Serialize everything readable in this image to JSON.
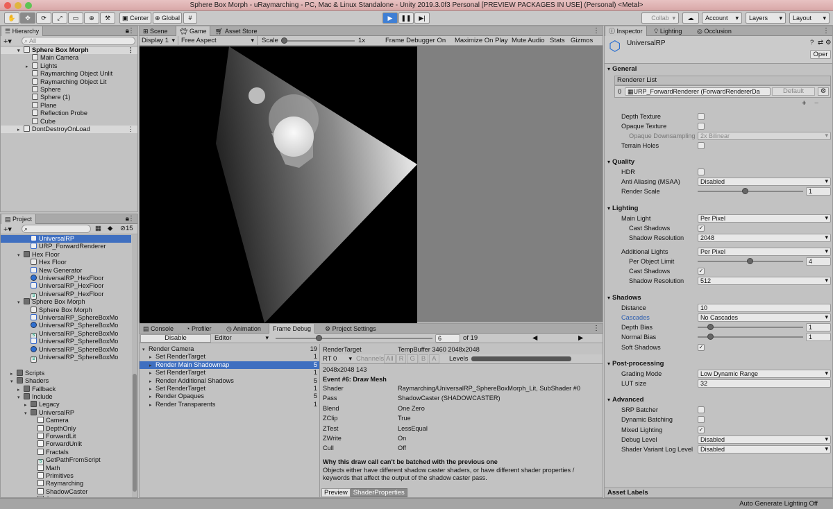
{
  "window": {
    "title": "Sphere Box Morph - uRaymarching - PC, Mac & Linux Standalone - Unity 2019.3.0f3 Personal [PREVIEW PACKAGES IN USE] (Personal) <Metal>"
  },
  "toolbar": {
    "center_label": "Center",
    "global_label": "Global",
    "collab_label": "Collab",
    "account_label": "Account",
    "layers_label": "Layers",
    "layout_label": "Layout"
  },
  "hierarchy": {
    "tab": "Hierarchy",
    "search_placeholder": "All",
    "items": [
      {
        "label": "Sphere Box Morph",
        "indent": 0,
        "icon": "scene",
        "arrow": "▾"
      },
      {
        "label": "Main Camera",
        "indent": 1,
        "icon": "cube",
        "arrow": ""
      },
      {
        "label": "Lights",
        "indent": 1,
        "icon": "cube",
        "arrow": "▸"
      },
      {
        "label": "Raymarching Object Unlit",
        "indent": 1,
        "icon": "cube",
        "arrow": ""
      },
      {
        "label": "Raymarching Object Lit",
        "indent": 1,
        "icon": "cube",
        "arrow": ""
      },
      {
        "label": "Sphere",
        "indent": 1,
        "icon": "cube",
        "arrow": ""
      },
      {
        "label": "Sphere (1)",
        "indent": 1,
        "icon": "cube",
        "arrow": ""
      },
      {
        "label": "Plane",
        "indent": 1,
        "icon": "cube",
        "arrow": ""
      },
      {
        "label": "Reflection Probe",
        "indent": 1,
        "icon": "cube",
        "arrow": ""
      },
      {
        "label": "Cube",
        "indent": 1,
        "icon": "cube",
        "arrow": ""
      },
      {
        "label": "DontDestroyOnLoad",
        "indent": 0,
        "icon": "scene",
        "arrow": "▸"
      }
    ]
  },
  "project": {
    "tab": "Project",
    "count": "15",
    "items": [
      {
        "label": "UniversalRP",
        "indent": 3,
        "icon": "urp",
        "arrow": "",
        "sel": true
      },
      {
        "label": "URP_ForwardRenderer",
        "indent": 3,
        "icon": "urp",
        "arrow": ""
      },
      {
        "label": "Hex Floor",
        "indent": 2,
        "icon": "folder",
        "arrow": "▾"
      },
      {
        "label": "Hex Floor",
        "indent": 3,
        "icon": "cube",
        "arrow": ""
      },
      {
        "label": "New Generator",
        "indent": 3,
        "icon": "urp",
        "arrow": ""
      },
      {
        "label": "UniversalRP_HexFloor",
        "indent": 3,
        "icon": "sphere",
        "arrow": ""
      },
      {
        "label": "UniversalRP_HexFloor",
        "indent": 3,
        "icon": "urp",
        "arrow": ""
      },
      {
        "label": "UniversalRP_HexFloor",
        "indent": 3,
        "icon": "script",
        "arrow": ""
      },
      {
        "label": "Sphere Box Morph",
        "indent": 2,
        "icon": "folder",
        "arrow": "▾"
      },
      {
        "label": "Sphere Box Morph",
        "indent": 3,
        "icon": "cube",
        "arrow": ""
      },
      {
        "label": "UniversalRP_SphereBoxMo",
        "indent": 3,
        "icon": "urp",
        "arrow": ""
      },
      {
        "label": "UniversalRP_SphereBoxMo",
        "indent": 3,
        "icon": "sphere",
        "arrow": ""
      },
      {
        "label": "UniversalRP_SphereBoxMo",
        "indent": 3,
        "icon": "script",
        "arrow": ""
      },
      {
        "label": "UniversalRP_SphereBoxMo",
        "indent": 3,
        "icon": "urp",
        "arrow": ""
      },
      {
        "label": "UniversalRP_SphereBoxMo",
        "indent": 3,
        "icon": "sphere",
        "arrow": ""
      },
      {
        "label": "UniversalRP_SphereBoxMo",
        "indent": 3,
        "icon": "script",
        "arrow": ""
      },
      {
        "label": "",
        "indent": 0,
        "icon": "none",
        "arrow": ""
      },
      {
        "label": "Scripts",
        "indent": 1,
        "icon": "folder",
        "arrow": "▸"
      },
      {
        "label": "Shaders",
        "indent": 1,
        "icon": "folder",
        "arrow": "▾"
      },
      {
        "label": "Fallback",
        "indent": 2,
        "icon": "folder",
        "arrow": "▸"
      },
      {
        "label": "Include",
        "indent": 2,
        "icon": "folder",
        "arrow": "▾"
      },
      {
        "label": "Legacy",
        "indent": 3,
        "icon": "folder",
        "arrow": "▸"
      },
      {
        "label": "UniversalRP",
        "indent": 3,
        "icon": "folder",
        "arrow": "▾"
      },
      {
        "label": "Camera",
        "indent": 4,
        "icon": "file",
        "arrow": ""
      },
      {
        "label": "DepthOnly",
        "indent": 4,
        "icon": "file",
        "arrow": ""
      },
      {
        "label": "ForwardLit",
        "indent": 4,
        "icon": "file",
        "arrow": ""
      },
      {
        "label": "ForwardUnlit",
        "indent": 4,
        "icon": "file",
        "arrow": ""
      },
      {
        "label": "Fractals",
        "indent": 4,
        "icon": "file",
        "arrow": ""
      },
      {
        "label": "GetPathFromScript",
        "indent": 4,
        "icon": "script",
        "arrow": ""
      },
      {
        "label": "Math",
        "indent": 4,
        "icon": "file",
        "arrow": ""
      },
      {
        "label": "Primitives",
        "indent": 4,
        "icon": "file",
        "arrow": ""
      },
      {
        "label": "Raymarching",
        "indent": 4,
        "icon": "file",
        "arrow": ""
      },
      {
        "label": "ShadowCaster",
        "indent": 4,
        "icon": "file",
        "arrow": ""
      },
      {
        "label": "Structs",
        "indent": 4,
        "icon": "file",
        "arrow": ""
      }
    ]
  },
  "game": {
    "tabs": [
      "Scene",
      "Game",
      "Asset Store"
    ],
    "display": "Display 1",
    "aspect": "Free Aspect",
    "scale_label": "Scale",
    "scale_value": "1x",
    "frame_debugger": "Frame Debugger On",
    "maximize": "Maximize On Play",
    "mute": "Mute Audio",
    "stats": "Stats",
    "gizmos": "Gizmos"
  },
  "framedebug": {
    "tabs": [
      "Console",
      "Profiler",
      "Animation",
      "Frame Debug",
      "Project Settings"
    ],
    "disable_label": "Disable",
    "editor_label": "Editor",
    "event_index": "6",
    "event_total": "of 19",
    "tree": [
      {
        "label": "Render Camera",
        "count": "19",
        "indent": 0,
        "arrow": "▾"
      },
      {
        "label": "Set RenderTarget",
        "count": "1",
        "indent": 1,
        "arrow": "▸"
      },
      {
        "label": "Render Main Shadowmap",
        "count": "5",
        "indent": 1,
        "arrow": "▸",
        "sel": true
      },
      {
        "label": "Set RenderTarget",
        "count": "1",
        "indent": 1,
        "arrow": "▸"
      },
      {
        "label": "Render Additional Shadows",
        "count": "5",
        "indent": 1,
        "arrow": "▸"
      },
      {
        "label": "Set RenderTarget",
        "count": "1",
        "indent": 1,
        "arrow": "▸"
      },
      {
        "label": "Render Opaques",
        "count": "5",
        "indent": 1,
        "arrow": "▸"
      },
      {
        "label": "Render Transparents",
        "count": "1",
        "indent": 1,
        "arrow": "▸"
      }
    ],
    "rendertarget_label": "RenderTarget",
    "rendertarget_value": "TempBuffer 3460 2048x2048",
    "rt_select": "RT 0",
    "channels_label": "Channels",
    "channels": [
      "All",
      "R",
      "G",
      "B",
      "A"
    ],
    "levels_label": "Levels",
    "size_line": "2048x2048 143",
    "event_title": "Event #6: Draw Mesh",
    "props": [
      {
        "k": "Shader",
        "v": "Raymarching/UniversalRP_SphereBoxMorph_Lit, SubShader #0"
      },
      {
        "k": "Pass",
        "v": "ShadowCaster (SHADOWCASTER)"
      },
      {
        "k": "Blend",
        "v": "One Zero"
      },
      {
        "k": "ZClip",
        "v": "True"
      },
      {
        "k": "ZTest",
        "v": "LessEqual"
      },
      {
        "k": "ZWrite",
        "v": "On"
      },
      {
        "k": "Cull",
        "v": "Off"
      }
    ],
    "batch_title": "Why this draw call can't be batched with the previous one",
    "batch_text_1": "Objects either have different shadow caster shaders, or have different shader properties /",
    "batch_text_2": "keywords that affect the output of the shadow caster pass.",
    "bottom_tabs": [
      "Preview",
      "ShaderProperties"
    ]
  },
  "inspector": {
    "tabs": [
      "Inspector",
      "Lighting",
      "Occlusion"
    ],
    "asset_name": "UniversalRP",
    "open_label": "Oper",
    "general": "General",
    "renderer_list": "Renderer List",
    "renderer_index": "0",
    "renderer_value": "URP_ForwardRenderer (ForwardRendererDa",
    "default_label": "Default",
    "depth_texture": "Depth Texture",
    "opaque_texture": "Opaque Texture",
    "opaque_downsampling": "Opaque Downsampling",
    "opaque_downsampling_value": "2x Bilinear",
    "terrain_holes": "Terrain Holes",
    "quality": "Quality",
    "hdr": "HDR",
    "anti_aliasing": "Anti Aliasing (MSAA)",
    "anti_aliasing_value": "Disabled",
    "render_scale": "Render Scale",
    "render_scale_value": "1",
    "render_scale_level": 0.45,
    "lighting": "Lighting",
    "main_light": "Main Light",
    "main_light_value": "Per Pixel",
    "cast_shadows": "Cast Shadows",
    "shadow_resolution": "Shadow Resolution",
    "shadow_resolution_value": "2048",
    "additional_lights": "Additional Lights",
    "additional_lights_value": "Per Pixel",
    "per_object_limit": "Per Object Limit",
    "per_object_limit_value": "4",
    "per_object_limit_level": 0.5,
    "add_cast_shadows": "Cast Shadows",
    "add_shadow_resolution": "Shadow Resolution",
    "add_shadow_resolution_value": "512",
    "shadows": "Shadows",
    "distance": "Distance",
    "distance_value": "10",
    "cascades": "Cascades",
    "cascades_value": "No Cascades",
    "depth_bias": "Depth Bias",
    "depth_bias_value": "1",
    "depth_bias_level": 0.1,
    "normal_bias": "Normal Bias",
    "normal_bias_value": "1",
    "normal_bias_level": 0.1,
    "soft_shadows": "Soft Shadows",
    "post_processing": "Post-processing",
    "grading_mode": "Grading Mode",
    "grading_mode_value": "Low Dynamic Range",
    "lut_size": "LUT size",
    "lut_size_value": "32",
    "advanced": "Advanced",
    "srp_batcher": "SRP Batcher",
    "dynamic_batching": "Dynamic Batching",
    "mixed_lighting": "Mixed Lighting",
    "debug_level": "Debug Level",
    "debug_level_value": "Disabled",
    "shader_variant": "Shader Variant Log Level",
    "shader_variant_value": "Disabled",
    "asset_labels": "Asset Labels"
  },
  "status": {
    "text": "Auto Generate Lighting Off"
  },
  "colors": {
    "accent": "#3f6fc0",
    "play": "#3f7fd4",
    "title_bg": "#e0b4b4"
  }
}
